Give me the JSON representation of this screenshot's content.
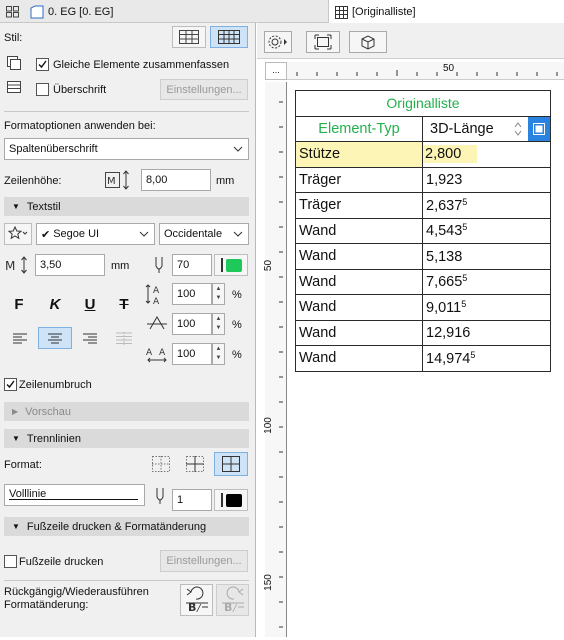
{
  "tabs": {
    "left_label": "0. EG [0. EG]",
    "right_label": "[Originalliste]"
  },
  "panel": {
    "stil_label": "Stil:",
    "gleiche_label": "Gleiche Elemente zusammenfassen",
    "gleiche_checked": true,
    "ueberschrift_label": "Überschrift",
    "ueberschrift_checked": false,
    "einstellungen_label": "Einstellungen...",
    "formatoptionen_label": "Formatoptionen anwenden bei:",
    "apply_dropdown": "Spaltenüberschrift",
    "zeilenhoehe_label": "Zeilenhöhe:",
    "zeilenhoehe_value": "8,00",
    "unit_mm": "mm",
    "textstil_section": "Textstil",
    "font_name": "Segoe UI",
    "font_script": "Occidentale",
    "text_size": "3,50",
    "pen_number": "70",
    "pen_color": "#1ec95a",
    "style_buttons": [
      "F",
      "K",
      "U",
      "T"
    ],
    "spacing_values": [
      "100",
      "100",
      "100"
    ],
    "percent": "%",
    "zeilenumbruch_label": "Zeilenumbruch",
    "zeilenumbruch_checked": true,
    "vorschau_section": "Vorschau",
    "trennlinien_section": "Trennlinien",
    "format_label": "Format:",
    "line_type": "Volllinie",
    "line_pen": "1",
    "fusszeile_section": "Fußzeile drucken & Formatänderung",
    "fusszeile_label": "Fußzeile drucken",
    "fusszeile_checked": false,
    "undo_label": "Rückgängig/Wiederausführen Formatänderung:"
  },
  "ruler": {
    "corner": "...",
    "h_label": "50",
    "v_labels": [
      "50",
      "100",
      "150"
    ]
  },
  "table": {
    "title": "Originalliste",
    "col1_header": "Element-Typ",
    "col2_header": "3D-Länge",
    "rows": [
      {
        "type": "Stütze",
        "value": "2,800",
        "sup": ""
      },
      {
        "type": "Träger",
        "value": "1,923",
        "sup": ""
      },
      {
        "type": "Träger",
        "value": "2,637",
        "sup": "5"
      },
      {
        "type": "Wand",
        "value": "4,543",
        "sup": "5"
      },
      {
        "type": "Wand",
        "value": "5,138",
        "sup": ""
      },
      {
        "type": "Wand",
        "value": "7,665",
        "sup": "5"
      },
      {
        "type": "Wand",
        "value": "9,011",
        "sup": "5"
      },
      {
        "type": "Wand",
        "value": "12,916",
        "sup": ""
      },
      {
        "type": "Wand",
        "value": "14,974",
        "sup": "5"
      }
    ],
    "highlight_color": "#fdf5b5",
    "accent_color": "#23b14d"
  }
}
